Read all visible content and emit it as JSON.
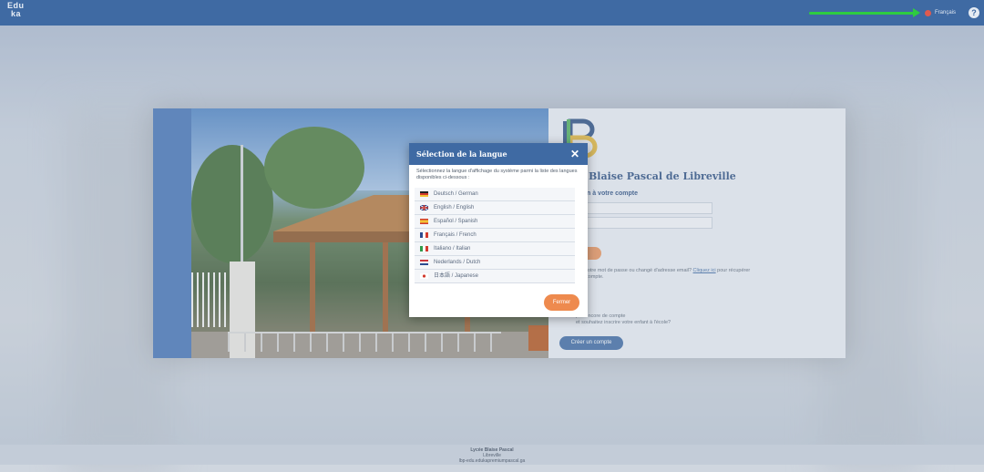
{
  "topbar": {
    "logo_line1": "Edu",
    "logo_line2": "ka",
    "current_language": "Français",
    "help_glyph": "?",
    "accent_color": "#3f6aa3",
    "arrow_color": "#2ecc40"
  },
  "login": {
    "school_name": "Blaise Pascal de Libreville",
    "connect_title": "n à votre compte",
    "help_text_before": "blié votre mot de passe ou changé d'adresse email?",
    "help_link": "Cliquez ici",
    "help_text_after": "pour récupérer",
    "help_text_line2": "otre compte.",
    "noaccount_title": "",
    "noaccount_text_line1": "pas encore de compte",
    "noaccount_text_line2": "et souhaitez inscrire votre enfant à l'école?",
    "create_account": "Créer un compte"
  },
  "modal": {
    "title": "Sélection de la langue",
    "close_glyph": "✕",
    "description": "Sélectionnez la langue d'affichage du système parmi la liste des langues disponibles ci-dessous :",
    "languages": [
      {
        "label": "Deutsch / German",
        "flag": "de-flag-icon"
      },
      {
        "label": "English / English",
        "flag": "gb-flag-icon"
      },
      {
        "label": "Español / Spanish",
        "flag": "es-flag-icon"
      },
      {
        "label": "Français / French",
        "flag": "fr-flag-icon"
      },
      {
        "label": "Italiano / Italian",
        "flag": "it-flag-icon"
      },
      {
        "label": "Nederlands / Dutch",
        "flag": "nl-flag-icon"
      },
      {
        "label": "日本語 / Japanese",
        "flag": "jp-flag-icon"
      }
    ],
    "close_button": "Fermer",
    "close_button_color": "#ee8a4e"
  },
  "footer": {
    "line1": "Lycée Blaise Pascal",
    "line2": "Libreville",
    "line3": "lbp-edu.edukapremiumpascal.ga"
  }
}
